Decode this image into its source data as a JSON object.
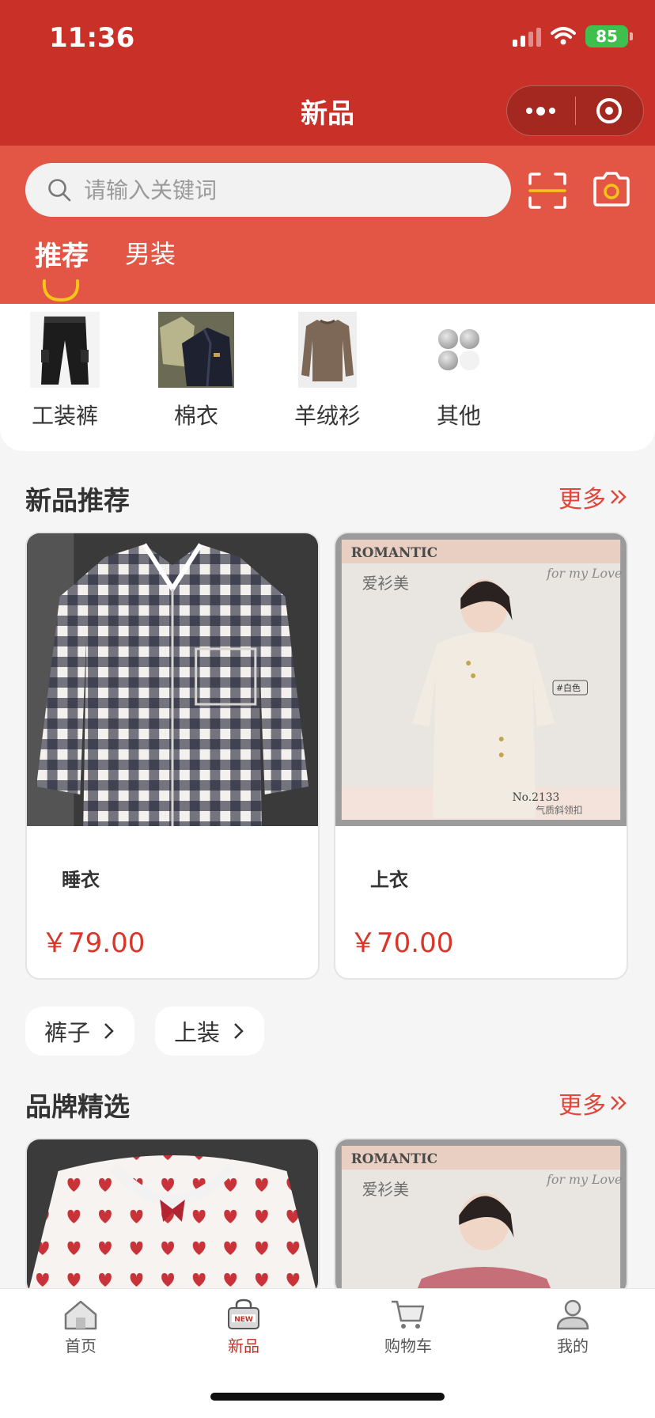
{
  "status_bar": {
    "time": "11:36",
    "battery": "85"
  },
  "nav": {
    "title": "新品"
  },
  "search": {
    "placeholder": "请输入关键词"
  },
  "tabs": [
    {
      "label": "推荐",
      "active": true
    },
    {
      "label": "男装",
      "active": false
    }
  ],
  "categories": [
    {
      "label": "工装裤",
      "icon": "pants-thumbnail"
    },
    {
      "label": "棉衣",
      "icon": "jacket-thumbnail"
    },
    {
      "label": "羊绒衫",
      "icon": "sweater-thumbnail"
    },
    {
      "label": "其他",
      "icon": "grid-icon"
    }
  ],
  "new_products": {
    "title": "新品推荐",
    "more": "更多",
    "items": [
      {
        "name": "睡衣",
        "price": "￥79.00",
        "image": "plaid-shirt-photo"
      },
      {
        "name": "上衣",
        "price": "￥70.00",
        "image": "model-cream-top-photo",
        "poster_brand": "ROMANTIC",
        "poster_brand_cn": "爱衫美",
        "poster_script": "for my Love",
        "poster_color_tag": "#白色",
        "poster_no": "No.2133",
        "poster_caption": "气质斜领扣"
      }
    ]
  },
  "quick_chips": [
    {
      "label": "裤子"
    },
    {
      "label": "上装"
    }
  ],
  "brand_selection": {
    "title": "品牌精选",
    "more": "更多",
    "items": [
      {
        "image": "heart-print-pajama-photo"
      },
      {
        "image": "model-pink-sweater-photo",
        "poster_brand": "ROMANTIC",
        "poster_brand_cn": "爱衫美",
        "poster_script": "for my Love"
      }
    ]
  },
  "tabbar": [
    {
      "label": "首页",
      "icon": "home-icon",
      "active": false
    },
    {
      "label": "新品",
      "icon": "new-bag-icon",
      "active": true
    },
    {
      "label": "购物车",
      "icon": "cart-icon",
      "active": false
    },
    {
      "label": "我的",
      "icon": "user-icon",
      "active": false
    }
  ],
  "colors": {
    "primary": "#c93128",
    "search_band": "#e35645",
    "price": "#d9362a",
    "active_tab_indicator": "#f5c518",
    "battery": "#3fbf4e"
  }
}
